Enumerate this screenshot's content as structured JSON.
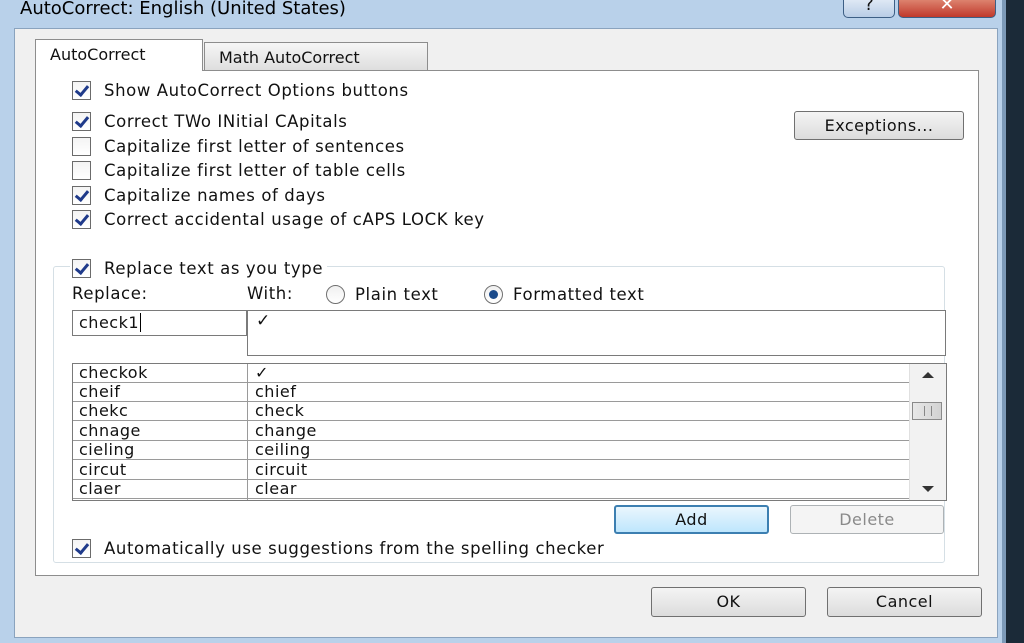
{
  "window": {
    "title": "AutoCorrect: English (United States)",
    "help_glyph": "?",
    "close_glyph": "✕"
  },
  "tabs": [
    {
      "label": "AutoCorrect",
      "active": true
    },
    {
      "label": "Math AutoCorrect",
      "active": false
    }
  ],
  "options": {
    "show_buttons": {
      "label": "Show AutoCorrect Options buttons",
      "checked": true
    },
    "two_initials": {
      "label": "Correct TWo INitial CApitals",
      "checked": true
    },
    "first_sentence": {
      "label": "Capitalize first letter of sentences",
      "checked": false
    },
    "first_table_cell": {
      "label": "Capitalize first letter of table cells",
      "checked": false
    },
    "names_of_days": {
      "label": "Capitalize names of days",
      "checked": true
    },
    "caps_lock": {
      "label": "Correct accidental usage of cAPS LOCK key",
      "checked": true
    }
  },
  "exceptions_label": "Exceptions...",
  "replace_group": {
    "label": "Replace text as you type",
    "checked": true,
    "replace_label": "Replace:",
    "with_label": "With:",
    "plain_text_label": "Plain text",
    "formatted_text_label": "Formatted text",
    "selected_mode": "formatted",
    "replace_value": "check1",
    "with_value": "✓"
  },
  "entries": [
    {
      "replace": "checkok",
      "with": "✓"
    },
    {
      "replace": "cheif",
      "with": "chief"
    },
    {
      "replace": "chekc",
      "with": "check"
    },
    {
      "replace": "chnage",
      "with": "change"
    },
    {
      "replace": "cieling",
      "with": "ceiling"
    },
    {
      "replace": "circut",
      "with": "circuit"
    },
    {
      "replace": "claer",
      "with": "clear"
    }
  ],
  "add_label": "Add",
  "delete_label": "Delete",
  "spelling_suggestions": {
    "label": "Automatically use suggestions from the spelling checker",
    "checked": true
  },
  "ok_label": "OK",
  "cancel_label": "Cancel"
}
